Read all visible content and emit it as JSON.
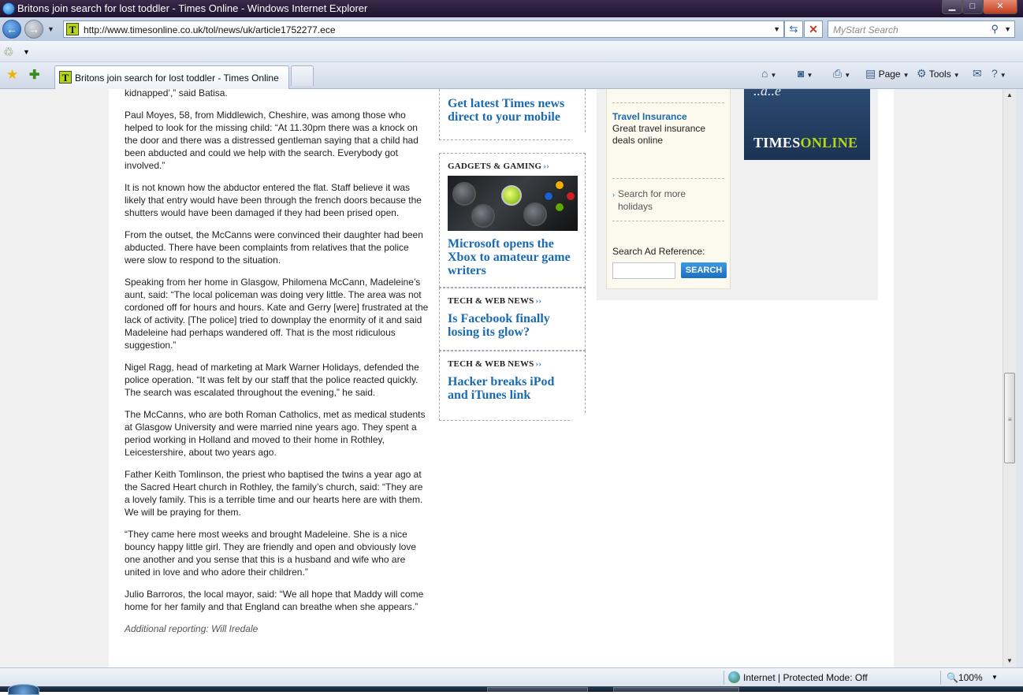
{
  "window": {
    "title": "Britons join search for lost toddler - Times Online - Windows Internet Explorer",
    "min": "▁",
    "max": "□",
    "close": "✕"
  },
  "nav": {
    "back_icon": "back-arrow-icon",
    "back": "←",
    "forward": "→",
    "history_dropdown": "▼",
    "address_favicon": "T",
    "url": "http://www.timesonline.co.uk/tol/news/uk/article1752277.ece",
    "address_dropdown": "▼",
    "refresh": "⇆",
    "stop": "✕",
    "search_placeholder": "MyStart Search",
    "search_icon": "⚲",
    "search_dropdown": "▼"
  },
  "command": {
    "translate_icon": "♲",
    "translate_dropdown": "▼"
  },
  "tabs": {
    "favorites_star": "★",
    "add_favorites": "✚",
    "active_tab_favicon": "T",
    "active_tab_label": "Britons join search for lost toddler - Times Online",
    "home_icon": "⌂",
    "feeds_icon": "◙",
    "print_icon": "⎙",
    "page_icon": "▤",
    "page_label": "Page",
    "tools_icon": "⚙",
    "tools_label": "Tools",
    "mail_icon": "✉",
    "help_icon": "?",
    "dropdown": "▼"
  },
  "article": {
    "top_fragment": "kidnapped’,” said Batisa.",
    "paragraphs": [
      "Paul Moyes, 58, from Middlewich, Cheshire, was among those who helped to look for the missing child: “At 11.30pm there was a knock on the door and there was a distressed gentleman saying that a child had been abducted and could we help with the search. Everybody got involved.”",
      "It is not known how the abductor entered the flat. Staff believe it was likely that entry would have been through the french doors because the shutters would have been damaged if they had been prised open.",
      "From the outset, the McCanns were convinced their daughter had been abducted. There have been complaints from relatives that the police were slow to respond to the situation.",
      "Speaking from her home in Glasgow, Philomena McCann, Madeleine’s aunt, said: “The local policeman was doing very little. The area was not cordoned off for hours and hours. Kate and Gerry [were] frustrated at the lack of activity. [The police] tried to downplay the enormity of it and said Madeleine had perhaps wandered off. That is the most ridiculous suggestion.”",
      "Nigel Ragg, head of marketing at Mark Warner Holidays, defended the police operation. “It was felt by our staff that the police reacted quickly. The search was escalated throughout the evening,” he said.",
      "The McCanns, who are both Roman Catholics, met as medical students at Glasgow University and were married nine years ago. They spent a period working in Holland and moved to their home in Rothley, Leicestershire, about two years ago.",
      "Father Keith Tomlinson, the priest who baptised the twins a year ago at the Sacred Heart church in Rothley, the family’s church, said: “They are a lovely family. This is a terrible time and our hearts here are with them. We will be praying for them.",
      "“They came here most weeks and brought Madeleine. She is a nice bouncy happy little girl. They are friendly and open and obviously love one another and you sense that this is a husband and wife who are united in love and who adore their children.”",
      "Julio Barroros, the local mayor, said: “We all hope that Maddy will come home for her family and that England can breathe when she appears.”"
    ],
    "credit": "Additional reporting: Will Iredale"
  },
  "promos": {
    "mobile_link": "Get latest Times news direct to your mobile",
    "gadgets_heading": "GADGETS & GAMING",
    "gadgets_link": "Microsoft opens the Xbox to amateur game writers",
    "tech1_heading": "TECH & WEB NEWS",
    "tech1_link": "Is Facebook finally losing its glow?",
    "tech2_heading": "TECH & WEB NEWS",
    "tech2_link": "Hacker breaks iPod and iTunes link",
    "arrows": "››"
  },
  "ad": {
    "title": "Travel Insurance",
    "desc": "Great travel insurance deals online",
    "more_bullet": "›",
    "more": "Search for more holidays",
    "ref_label": "Search Ad Reference:",
    "search_button": "SEARCH"
  },
  "banner": {
    "fragment": "..a..e",
    "logo_times": "TIMES",
    "logo_online": "ONLINE"
  },
  "scroll": {
    "up": "▲",
    "down": "▼",
    "grip": "≡"
  },
  "status": {
    "zone": "Internet | Protected Mode: Off",
    "zoom": "🔍100%",
    "zoom_dropdown": "▼"
  },
  "colors": {
    "link_blue": "#1a6bb0",
    "times_green": "#b5d614",
    "banner_navy": "#1b3355"
  }
}
